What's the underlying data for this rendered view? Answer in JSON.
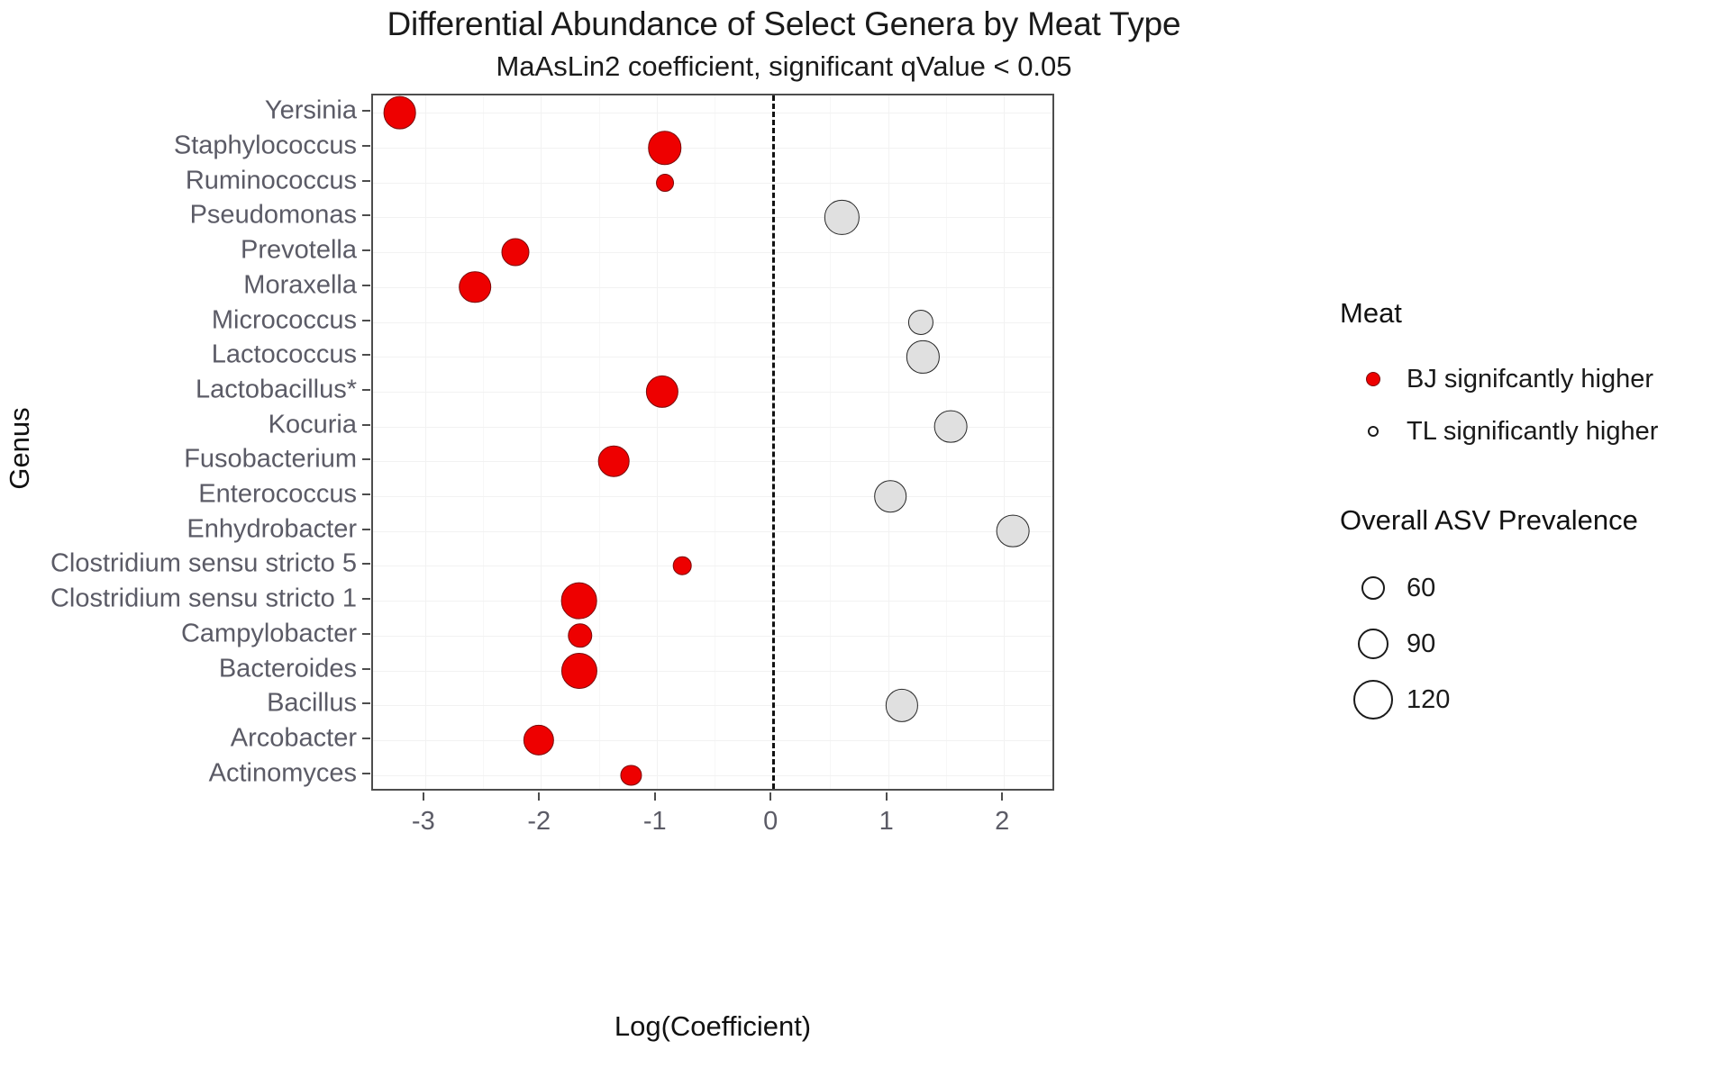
{
  "chart_data": {
    "type": "scatter",
    "title": "Differential Abundance of Select Genera by Meat Type",
    "subtitle": "MaAsLin2 coefficient, significant qValue < 0.05",
    "xlabel": "Log(Coefficient)",
    "ylabel": "Genus",
    "xlim": [
      -3.45,
      2.45
    ],
    "xticks": [
      -3,
      -2,
      -1,
      0,
      1,
      2
    ],
    "xtick_labels": [
      "-3",
      "-2",
      "-1",
      "0",
      "1",
      "2"
    ],
    "grid": true,
    "reference_line": {
      "x": 0,
      "style": "dashed",
      "color": "#111111"
    },
    "categories": [
      "Yersinia",
      "Staphylococcus",
      "Ruminococcus",
      "Pseudomonas",
      "Prevotella",
      "Moraxella",
      "Micrococcus",
      "Lactococcus",
      "Lactobacillus*",
      "Kocuria",
      "Fusobacterium",
      "Enterococcus",
      "Enhydrobacter",
      "Clostridium sensu stricto 5",
      "Clostridium sensu stricto 1",
      "Campylobacter",
      "Bacteroides",
      "Bacillus",
      "Arcobacter",
      "Actinomyces"
    ],
    "points": [
      {
        "genus": "Yersinia",
        "x": -3.22,
        "prevalence": 95,
        "group": "BJ signifcantly higher"
      },
      {
        "genus": "Staphylococcus",
        "x": -0.93,
        "prevalence": 100,
        "group": "BJ signifcantly higher"
      },
      {
        "genus": "Ruminococcus",
        "x": -0.93,
        "prevalence": 18,
        "group": "BJ signifcantly higher"
      },
      {
        "genus": "Pseudomonas",
        "x": 0.6,
        "prevalence": 105,
        "group": "TL significantly higher"
      },
      {
        "genus": "Prevotella",
        "x": -2.22,
        "prevalence": 62,
        "group": "BJ signifcantly higher"
      },
      {
        "genus": "Moraxella",
        "x": -2.57,
        "prevalence": 88,
        "group": "BJ signifcantly higher"
      },
      {
        "genus": "Micrococcus",
        "x": 1.28,
        "prevalence": 48,
        "group": "TL significantly higher"
      },
      {
        "genus": "Lactococcus",
        "x": 1.3,
        "prevalence": 92,
        "group": "TL significantly higher"
      },
      {
        "genus": "Lactobacillus*",
        "x": -0.95,
        "prevalence": 92,
        "group": "BJ signifcantly higher"
      },
      {
        "genus": "Kocuria",
        "x": 1.54,
        "prevalence": 95,
        "group": "TL significantly higher"
      },
      {
        "genus": "Fusobacterium",
        "x": -1.37,
        "prevalence": 82,
        "group": "BJ signifcantly higher"
      },
      {
        "genus": "Enterococcus",
        "x": 1.02,
        "prevalence": 88,
        "group": "TL significantly higher"
      },
      {
        "genus": "Enhydrobacter",
        "x": 2.08,
        "prevalence": 95,
        "group": "TL significantly higher"
      },
      {
        "genus": "Clostridium sensu stricto 5",
        "x": -0.78,
        "prevalence": 20,
        "group": "BJ signifcantly higher"
      },
      {
        "genus": "Clostridium sensu stricto 1",
        "x": -1.67,
        "prevalence": 122,
        "group": "BJ signifcantly higher"
      },
      {
        "genus": "Campylobacter",
        "x": -1.66,
        "prevalence": 45,
        "group": "BJ signifcantly higher"
      },
      {
        "genus": "Bacteroides",
        "x": -1.67,
        "prevalence": 118,
        "group": "BJ signifcantly higher"
      },
      {
        "genus": "Bacillus",
        "x": 1.12,
        "prevalence": 92,
        "group": "TL significantly higher"
      },
      {
        "genus": "Arcobacter",
        "x": -2.02,
        "prevalence": 80,
        "group": "BJ signifcantly higher"
      },
      {
        "genus": "Actinomyces",
        "x": -1.22,
        "prevalence": 28,
        "group": "BJ signifcantly higher"
      }
    ],
    "legend_position": "right",
    "color_legend": {
      "title": "Meat",
      "entries": [
        {
          "label": "BJ signifcantly higher",
          "color": "#ee0000"
        },
        {
          "label": "TL significantly higher",
          "color": "#ffffff"
        }
      ]
    },
    "size_legend": {
      "title": "Overall ASV Prevalence",
      "entries": [
        {
          "label": "60",
          "value": 60
        },
        {
          "label": "90",
          "value": 90
        },
        {
          "label": "120",
          "value": 120
        }
      ]
    }
  }
}
